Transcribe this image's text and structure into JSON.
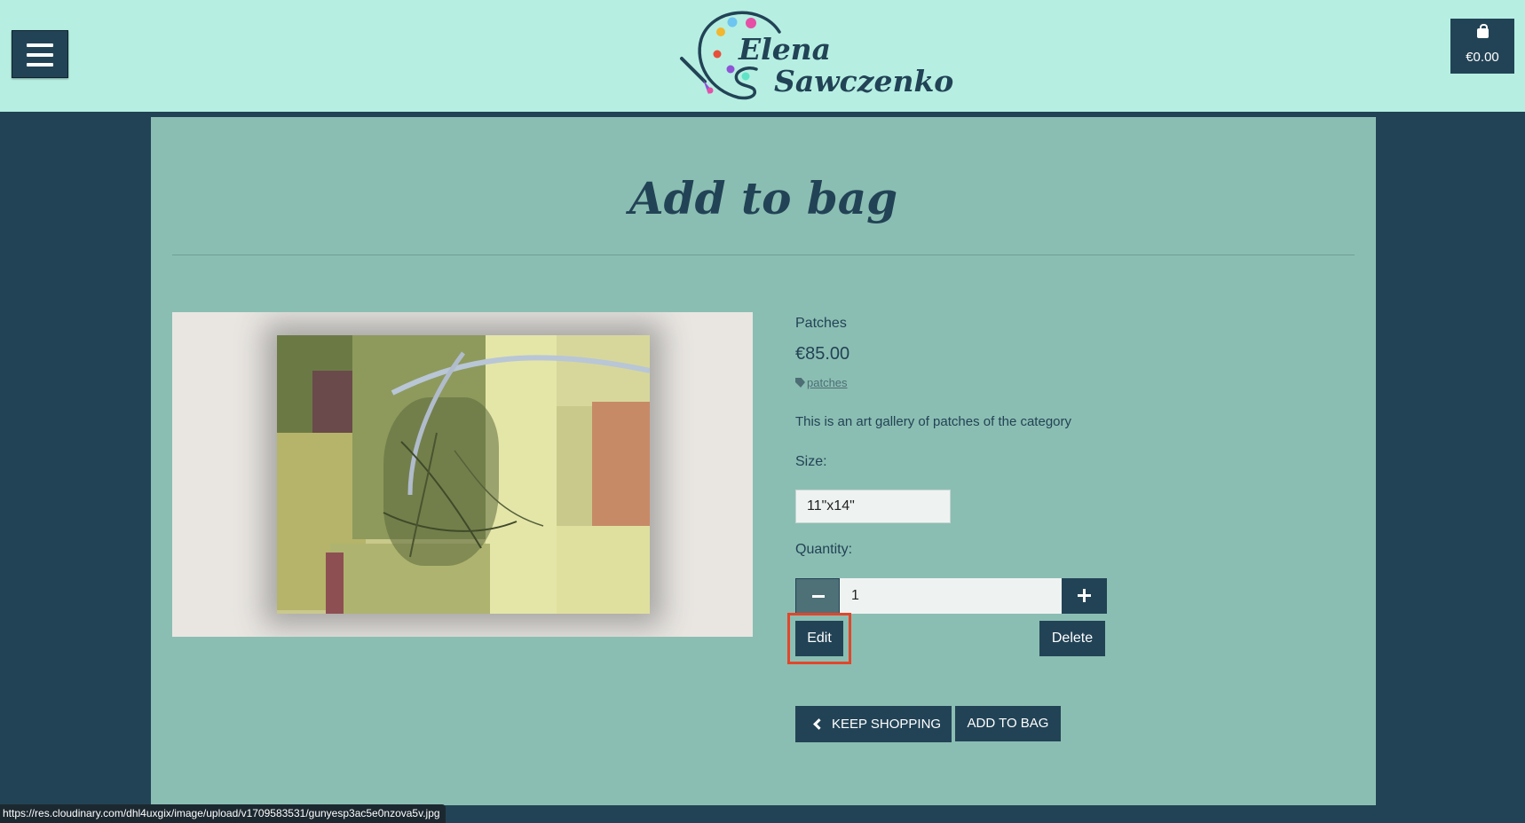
{
  "header": {
    "logo_first": "Elena",
    "logo_last": "Sawczenko",
    "cart_total": "€0.00",
    "colors": {
      "bar": "#b6efe2",
      "dark": "#224356"
    }
  },
  "page": {
    "title": "Add to bag"
  },
  "product": {
    "name": "Patches",
    "price": "€85.00",
    "tag": "patches",
    "description": "This is an art gallery of patches of the category",
    "size_label": "Size:",
    "size_value": "11\"x14\"",
    "quantity_label": "Quantity:",
    "quantity_value": "1"
  },
  "actions": {
    "edit": "Edit",
    "delete": "Delete",
    "keep_shopping": "KEEP SHOPPING",
    "add_to_bag": "ADD TO BAG"
  },
  "status_bar": {
    "url": "https://res.cloudinary.com/dhl4uxgix/image/upload/v1709583531/gunyesp3ac5e0nzova5v.jpg"
  }
}
